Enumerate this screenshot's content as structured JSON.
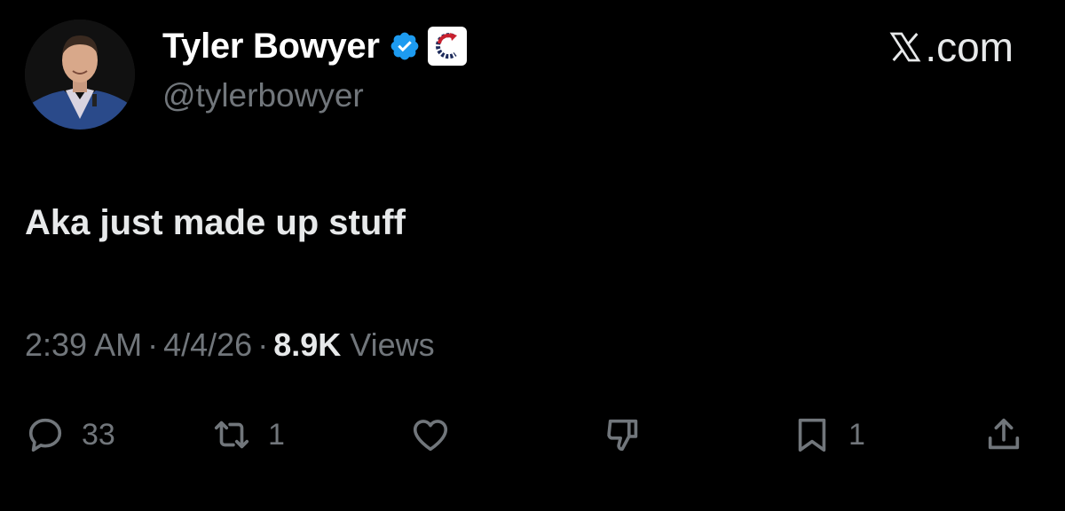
{
  "author": {
    "display_name": "Tyler Bowyer",
    "handle": "@tylerbowyer",
    "verified": true,
    "affiliation_badge_icon": "turning-point-logo-icon"
  },
  "brand": {
    "site": ".com"
  },
  "tweet": {
    "text": "Aka just made up stuff"
  },
  "meta": {
    "time": "2:39 AM",
    "separator": "·",
    "date": "4/4/26",
    "views_count": "8.9K",
    "views_label": "Views"
  },
  "actions": {
    "reply_count": "33",
    "repost_count": "1",
    "bookmark_count": "1"
  },
  "colors": {
    "background": "#000000",
    "primary_text": "#e7e9ea",
    "secondary_text": "#71767b",
    "verified_blue": "#1d9bf0"
  }
}
